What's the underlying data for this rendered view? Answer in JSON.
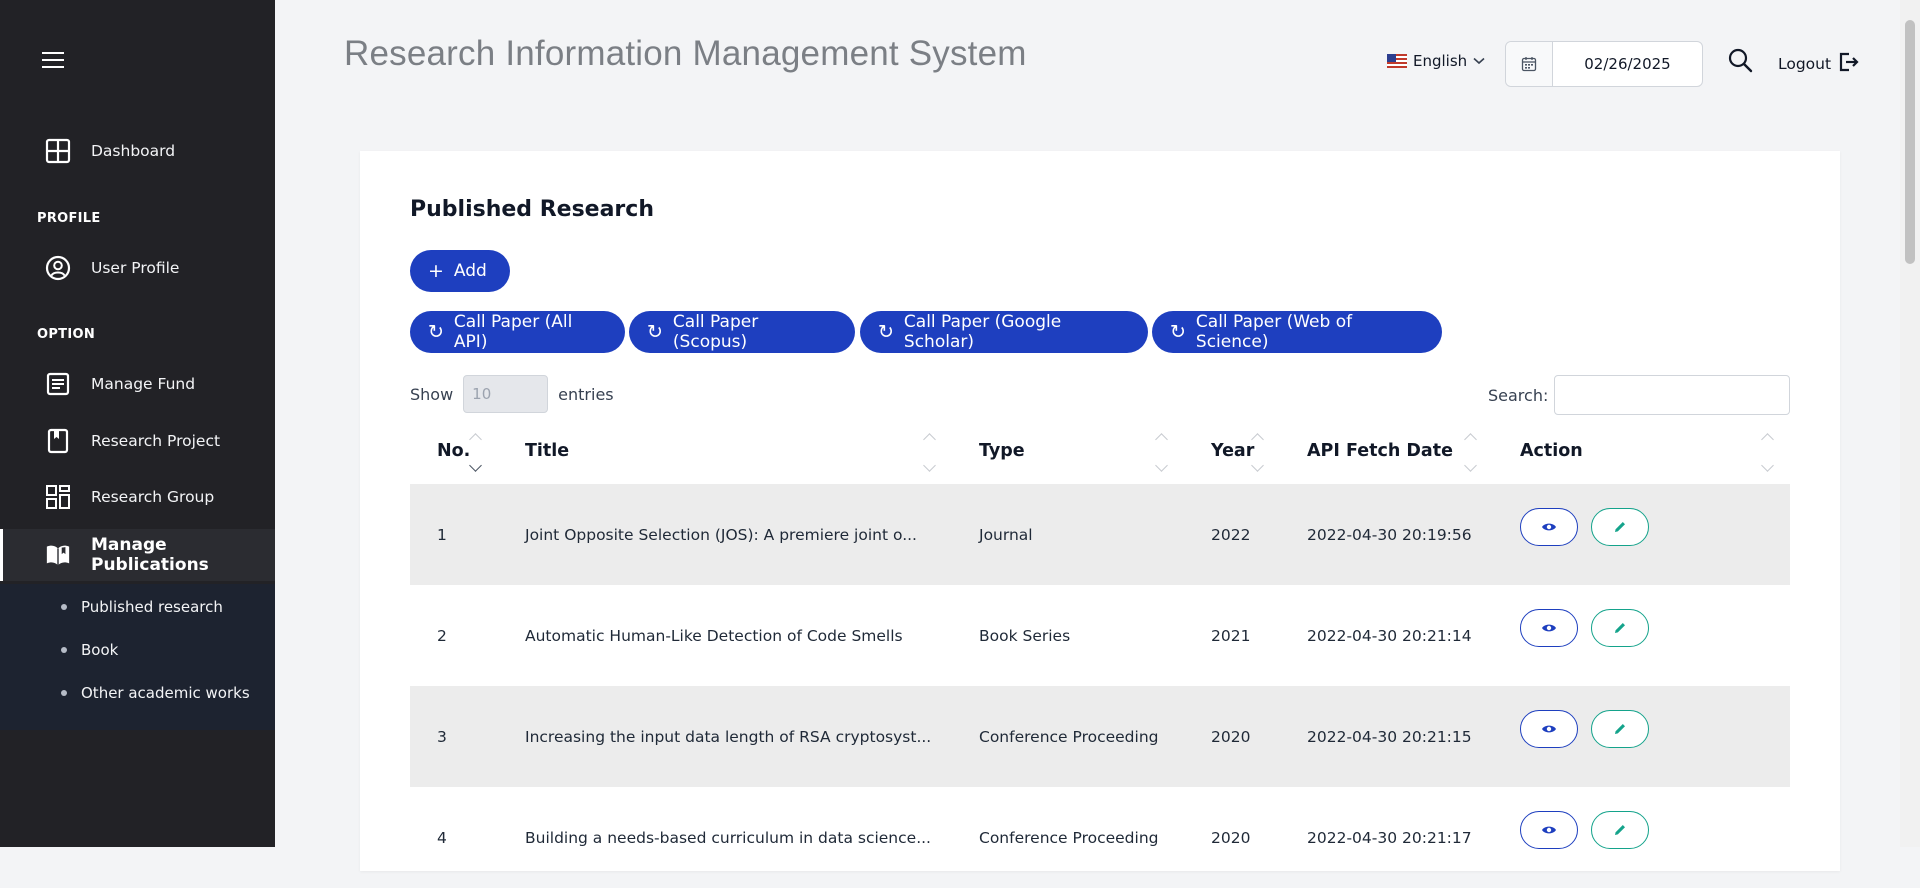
{
  "header": {
    "title": "Research Information Management System",
    "language": "English",
    "date": "02/26/2025",
    "logout": "Logout"
  },
  "sidebar": {
    "dashboard": "Dashboard",
    "profile_section": "PROFILE",
    "user_profile": "User Profile",
    "option_section": "OPTION",
    "manage_fund": "Manage Fund",
    "research_project": "Research Project",
    "research_group": "Research Group",
    "manage_publications": "Manage Publications",
    "submenu": [
      "Published research",
      "Book",
      "Other academic works"
    ]
  },
  "main": {
    "card_title": "Published Research",
    "add_label": "Add",
    "call_buttons": [
      "Call Paper (All API)",
      "Call Paper (Scopus)",
      "Call Paper (Google Scholar)",
      "Call Paper (Web of Science)"
    ],
    "show_label": "Show",
    "entries_value": "10",
    "entries_label": "entries",
    "search_label": "Search:",
    "columns": [
      "No.",
      "Title",
      "Type",
      "Year",
      "API Fetch Date",
      "Action"
    ],
    "rows": [
      {
        "no": "1",
        "title": "Joint Opposite Selection (JOS): A premiere joint o...",
        "type": "Journal",
        "year": "2022",
        "date": "2022-04-30 20:19:56"
      },
      {
        "no": "2",
        "title": "Automatic Human-Like Detection of Code Smells",
        "type": "Book Series",
        "year": "2021",
        "date": "2022-04-30 20:21:14"
      },
      {
        "no": "3",
        "title": "Increasing the input data length of RSA cryptosyst...",
        "type": "Conference Proceeding",
        "year": "2020",
        "date": "2022-04-30 20:21:15"
      },
      {
        "no": "4",
        "title": "Building a needs-based curriculum in data science...",
        "type": "Conference Proceeding",
        "year": "2020",
        "date": "2022-04-30 20:21:17"
      }
    ]
  },
  "colors": {
    "sidebar_bg": "#222226",
    "primary": "#1e3fbf",
    "edit": "#14a38b"
  }
}
